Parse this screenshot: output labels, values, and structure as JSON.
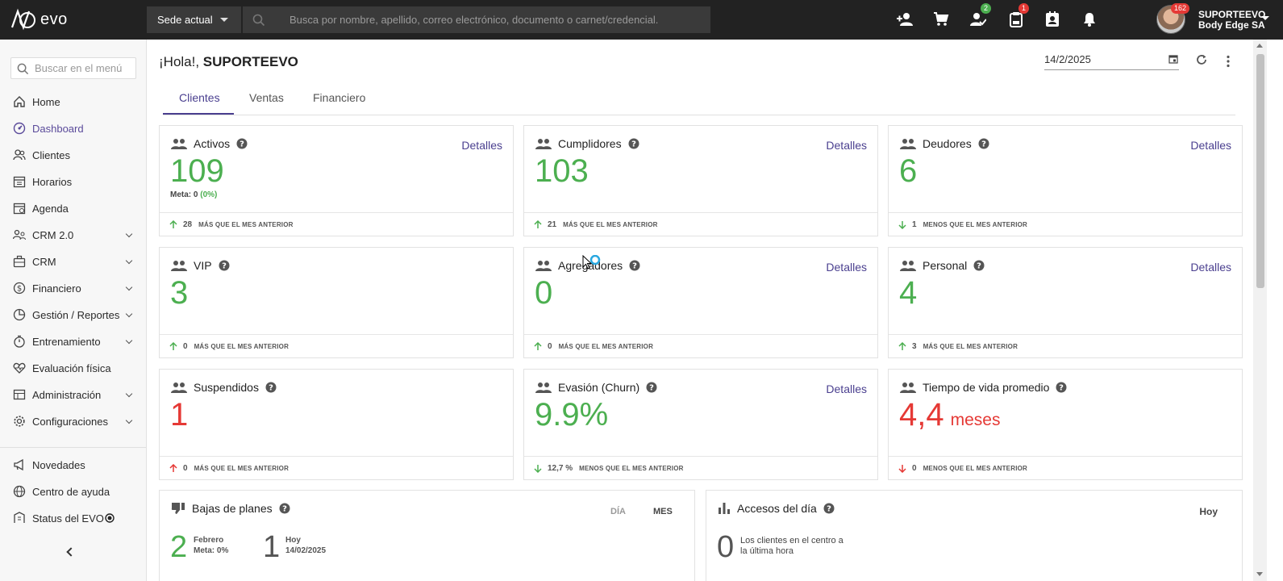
{
  "topbar": {
    "logo_text": "evo",
    "sede_label": "Sede actual",
    "search_placeholder": "Busca por nombre, apellido, correo electrónico, documento o carnet/credencial.",
    "icons": [
      "add-user-icon",
      "cart-icon",
      "user-check-icon",
      "clipboard-icon",
      "contact-card-icon",
      "bell-icon"
    ],
    "badge_user_check": "2",
    "badge_clipboard": "1",
    "avatar_badge": "162",
    "user_name": "SUPORTEEVO",
    "company": "Body Edge SA",
    "colors": {
      "bar": "#222222",
      "badge_green": "#4caf50",
      "badge_red": "#e53935"
    }
  },
  "sidebar": {
    "search_placeholder": "Buscar en el menú",
    "items": [
      {
        "label": "Home",
        "icon": "home-icon"
      },
      {
        "label": "Dashboard",
        "icon": "dashboard-icon",
        "active": true
      },
      {
        "label": "Clientes",
        "icon": "clients-icon"
      },
      {
        "label": "Horarios",
        "icon": "schedule-icon"
      },
      {
        "label": "Agenda",
        "icon": "agenda-icon"
      },
      {
        "label": "CRM 2.0",
        "icon": "crm2-icon",
        "expandable": true
      },
      {
        "label": "CRM",
        "icon": "crm-icon",
        "expandable": true
      },
      {
        "label": "Financiero",
        "icon": "money-icon",
        "expandable": true
      },
      {
        "label": "Gestión / Reportes",
        "icon": "reports-icon",
        "expandable": true
      },
      {
        "label": "Entrenamiento",
        "icon": "stopwatch-icon",
        "expandable": true
      },
      {
        "label": "Evaluación física",
        "icon": "heart-icon"
      },
      {
        "label": "Administración",
        "icon": "admin-icon",
        "expandable": true
      },
      {
        "label": "Configuraciones",
        "icon": "gear-icon",
        "expandable": true
      }
    ],
    "bottom": [
      {
        "label": "Novedades",
        "icon": "megaphone-icon"
      },
      {
        "label": "Centro de ayuda",
        "icon": "globe-icon"
      },
      {
        "label": "Status del EVO",
        "icon": "status-icon"
      }
    ]
  },
  "main": {
    "greeting_prefix": "¡Hola!, ",
    "greeting_name": "SUPORTEEVO",
    "date": "14/2/2025",
    "tabs": [
      "Clientes",
      "Ventas",
      "Financiero"
    ],
    "active_tab": "Clientes",
    "detail_label": "Detalles",
    "cards": [
      {
        "title": "Activos",
        "value": "109",
        "meta_label": "Meta: 0",
        "meta_pct": "(0%)",
        "trend": "up",
        "delta": "28",
        "delta_text": "más que el mes anterior",
        "detalles": true
      },
      {
        "title": "Cumplidores",
        "value": "103",
        "trend": "up",
        "delta": "21",
        "delta_text": "más que el mes anterior",
        "detalles": true
      },
      {
        "title": "Deudores",
        "value": "6",
        "trend": "down",
        "delta": "1",
        "delta_text": "menos que el mes anterior",
        "detalles": true
      },
      {
        "title": "VIP",
        "value": "3",
        "trend": "up",
        "delta": "0",
        "delta_text": "más que el mes anterior",
        "detalles": false
      },
      {
        "title": "Agregadores",
        "value": "0",
        "trend": "up",
        "delta": "0",
        "delta_text": "más que el mes anterior",
        "detalles": true
      },
      {
        "title": "Personal",
        "value": "4",
        "trend": "up",
        "delta": "3",
        "delta_text": "más que el mes anterior",
        "detalles": true
      },
      {
        "title": "Suspendidos",
        "value": "1",
        "value_color": "red",
        "trend": "up-red",
        "delta": "0",
        "delta_text": "más que el mes anterior",
        "detalles": false
      },
      {
        "title": "Evasión (Churn)",
        "value": "9.9%",
        "trend": "down",
        "delta": "12,7 %",
        "delta_text": "menos que el mes anterior",
        "detalles": true
      },
      {
        "title": "Tiempo de vida promedio",
        "value": "4,4",
        "value_unit": "meses",
        "value_color": "red",
        "trend": "down-red",
        "delta": "0",
        "delta_text": "menos que el mes anterior",
        "detalles": false
      }
    ],
    "bajas": {
      "title": "Bajas de planes",
      "option_day": "DÍA",
      "option_month": "MES",
      "month_value": "2",
      "month_label": "Febrero",
      "month_meta": "Meta: 0%",
      "today_value": "1",
      "today_label": "Hoy",
      "today_date": "14/02/2025"
    },
    "accesos": {
      "title": "Accesos del día",
      "value": "0",
      "desc_line1": "Los clientes en el centro a",
      "desc_line2": "la última hora",
      "hoy": "Hoy"
    },
    "colors": {
      "accent": "#4a3f8f",
      "positive": "#4caf50",
      "negative": "#e53935"
    }
  }
}
